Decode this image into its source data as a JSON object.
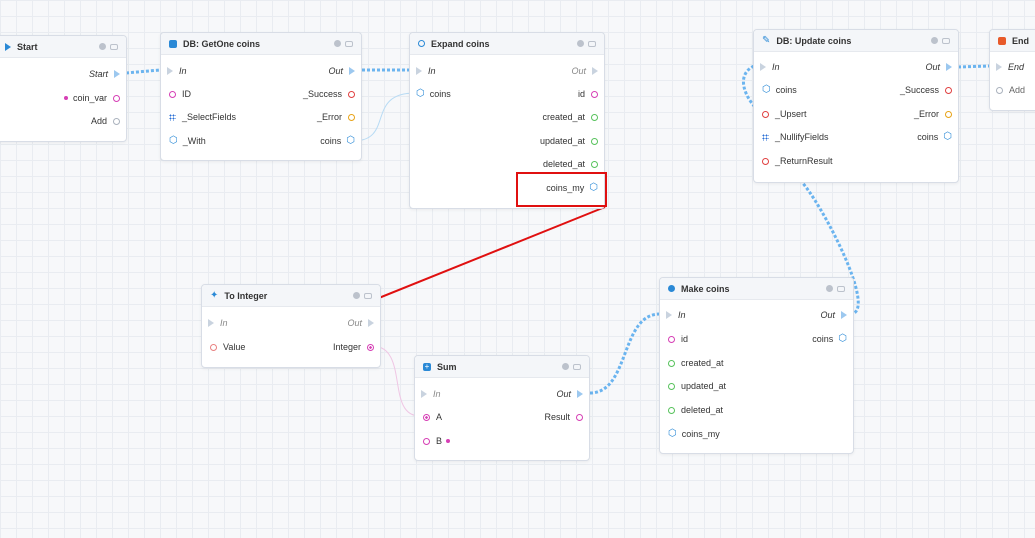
{
  "colors": {
    "accent": "#2a89d6",
    "flow": "#6bb4ef",
    "pin_pink": "#d63fb5",
    "pin_red": "#e04040",
    "pin_orange": "#e8a317",
    "pin_green": "#57c25c",
    "highlight": "#e01010"
  },
  "nodes": {
    "start": {
      "title": "Start",
      "out_exec": "Start",
      "var": "coin_var",
      "add": "Add"
    },
    "getone": {
      "title": "DB: GetOne coins",
      "in": "In",
      "out": "Out",
      "inputs": [
        "ID",
        "_SelectFields",
        "_With"
      ],
      "outputs": [
        "_Success",
        "_Error",
        "coins"
      ]
    },
    "expand": {
      "title": "Expand coins",
      "in": "In",
      "out": "Out",
      "input": "coins",
      "outputs": [
        "id",
        "created_at",
        "updated_at",
        "deleted_at",
        "coins_my"
      ]
    },
    "update": {
      "title": "DB: Update coins",
      "in": "In",
      "out": "Out",
      "inputs": [
        "coins",
        "_Upsert",
        "_NullifyFields",
        "_ReturnResult"
      ],
      "outputs": [
        "_Success",
        "_Error",
        "coins"
      ]
    },
    "end": {
      "title": "End",
      "in": "End",
      "add": "Add"
    },
    "tointeger": {
      "title": "To Integer",
      "in": "In",
      "out": "Out",
      "input": "Value",
      "output": "Integer"
    },
    "sum": {
      "title": "Sum",
      "in": "In",
      "out": "Out",
      "inputs": [
        "A",
        "B"
      ],
      "output": "Result"
    },
    "make": {
      "title": "Make coins",
      "in": "In",
      "out": "Out",
      "inputs": [
        "id",
        "created_at",
        "updated_at",
        "deleted_at",
        "coins_my"
      ],
      "output": "coins"
    }
  }
}
